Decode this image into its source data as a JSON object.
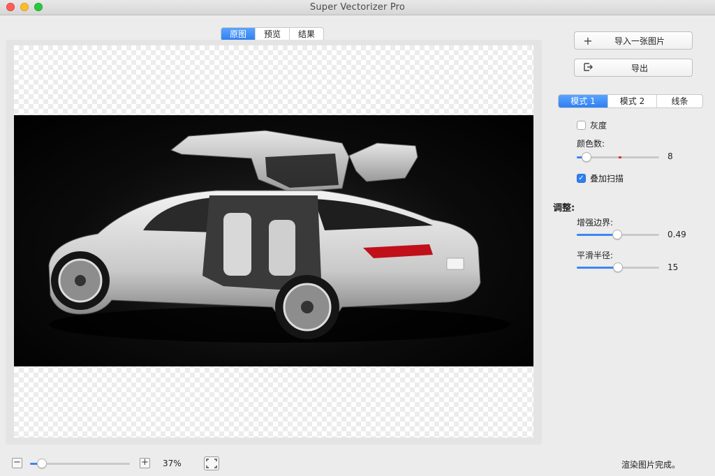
{
  "window": {
    "title": "Super Vectorizer Pro"
  },
  "view_tabs": [
    {
      "label": "原图",
      "active": true
    },
    {
      "label": "预览",
      "active": false
    },
    {
      "label": "结果",
      "active": false
    }
  ],
  "actions": {
    "import_label": "导入一张图片",
    "export_label": "导出"
  },
  "mode_tabs": [
    {
      "label": "模式 1",
      "active": true
    },
    {
      "label": "模式 2",
      "active": false
    },
    {
      "label": "线条",
      "active": false
    }
  ],
  "options": {
    "grayscale_label": "灰度",
    "grayscale_checked": false,
    "colors_label": "颜色数:",
    "colors_value": "8",
    "colors_fraction": 0.12,
    "overlay_label": "叠加扫描",
    "overlay_checked": true
  },
  "adjust": {
    "heading": "调整:",
    "edge_label": "增强边界:",
    "edge_value": "0.49",
    "edge_fraction": 0.49,
    "smooth_label": "平滑半径:",
    "smooth_value": "15",
    "smooth_fraction": 0.5
  },
  "zoom": {
    "value": "37%",
    "fraction": 0.12
  },
  "status": "渲染图片完成。",
  "accent_color": "#2f7ff0"
}
